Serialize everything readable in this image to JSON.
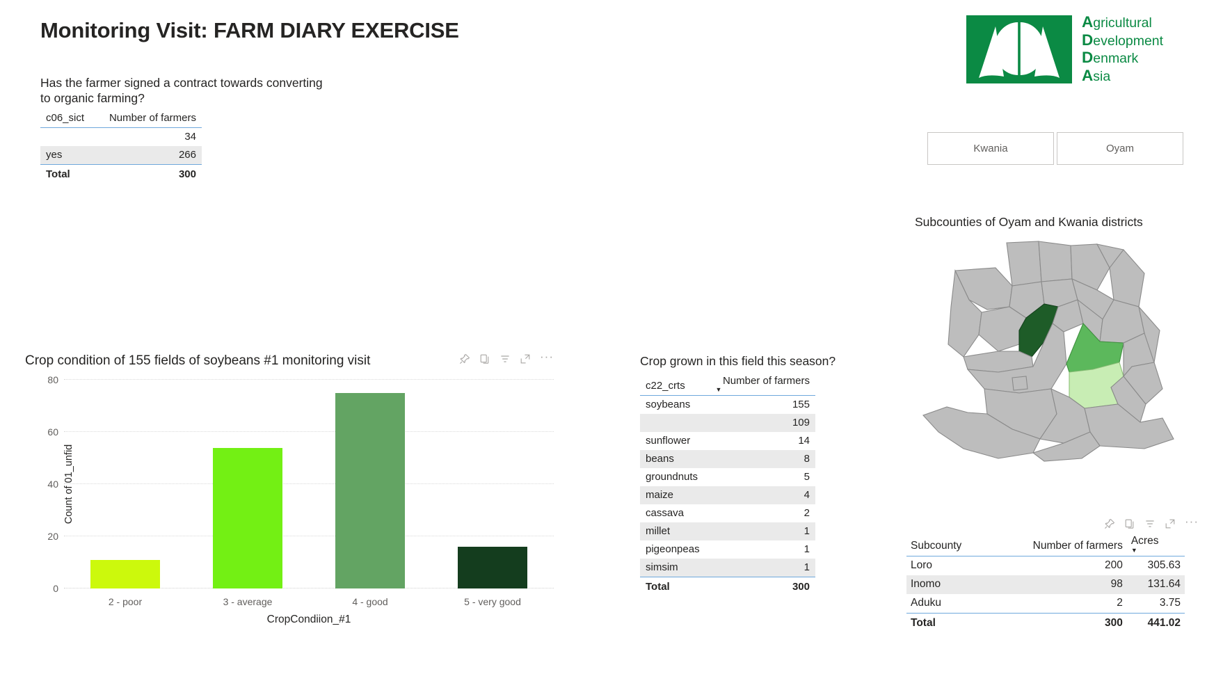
{
  "report": {
    "title": "Monitoring Visit: FARM DIARY EXERCISE"
  },
  "logo": {
    "mark_color": "#0b8a44",
    "line1_initial": "A",
    "line1_rest": "gricultural",
    "line2_initial": "D",
    "line2_rest": "evelopment",
    "line3_initial": "D",
    "line3_rest": "enmark",
    "line4_initial": "A",
    "line4_rest": "sia"
  },
  "slicer": {
    "buttons": [
      {
        "label": "Kwania"
      },
      {
        "label": "Oyam"
      }
    ]
  },
  "contract_visual": {
    "heading": "Has the farmer signed a contract towards converting to organic farming?",
    "columns": [
      "c06_sict",
      "Number of farmers"
    ],
    "rows": [
      {
        "label": "",
        "value": "34"
      },
      {
        "label": "yes",
        "value": "266"
      }
    ],
    "total_label": "Total",
    "total_value": "300"
  },
  "crop_visual": {
    "heading": "Crop grown in this field this season?",
    "columns": [
      "c22_crts",
      "Number of farmers"
    ],
    "sort_indicator": "▼",
    "rows": [
      {
        "label": "soybeans",
        "value": "155"
      },
      {
        "label": "",
        "value": "109"
      },
      {
        "label": "sunflower",
        "value": "14"
      },
      {
        "label": "beans",
        "value": "8"
      },
      {
        "label": "groundnuts",
        "value": "5"
      },
      {
        "label": "maize",
        "value": "4"
      },
      {
        "label": "cassava",
        "value": "2"
      },
      {
        "label": "millet",
        "value": "1"
      },
      {
        "label": "pigeonpeas",
        "value": "1"
      },
      {
        "label": "simsim",
        "value": "1"
      }
    ],
    "total_label": "Total",
    "total_value": "300"
  },
  "map_visual": {
    "title": "Subcounties of Oyam and Kwania districts",
    "region_default_fill": "#bdbdbd",
    "region_stroke": "#8a8a8a",
    "highlights": [
      {
        "name": "Loro",
        "fill": "#1e5c28"
      },
      {
        "name": "Inomo",
        "fill": "#5cb85c"
      },
      {
        "name": "Aduku",
        "fill": "#c8edb4"
      }
    ]
  },
  "subcounty_visual": {
    "columns": [
      "Subcounty",
      "Number of farmers",
      "Acres"
    ],
    "sort_indicator": "▼",
    "rows": [
      {
        "subcounty": "Loro",
        "farmers": "200",
        "acres": "305.63"
      },
      {
        "subcounty": "Inomo",
        "farmers": "98",
        "acres": "131.64"
      },
      {
        "subcounty": "Aduku",
        "farmers": "2",
        "acres": "3.75"
      }
    ],
    "total_label": "Total",
    "total_farmers": "300",
    "total_acres": "441.02"
  },
  "chart_data": {
    "type": "bar",
    "title": "Crop condition of 155 fields of soybeans #1 monitoring visit",
    "xlabel": "CropCondiion_#1",
    "ylabel": "Count of 01_unfid",
    "categories": [
      "2 - poor",
      "3 - average",
      "4 - good",
      "5 - very good"
    ],
    "values": [
      11,
      54,
      75,
      16
    ],
    "colors": [
      "#ccf90c",
      "#73f014",
      "#63a463",
      "#143d1e"
    ],
    "ylim": [
      0,
      80
    ],
    "yticks": [
      0,
      20,
      40,
      60,
      80
    ],
    "grid": true,
    "legend": "none"
  },
  "icons": {
    "pin": "pin-icon",
    "copy": "copy-icon",
    "filter": "filter-icon",
    "focus": "focus-mode-icon",
    "more": "more-options-icon"
  }
}
